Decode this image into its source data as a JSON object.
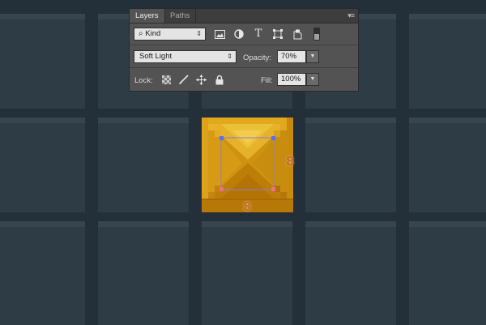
{
  "panel": {
    "tabs": [
      {
        "label": "Layers",
        "active": true
      },
      {
        "label": "Paths",
        "active": false
      }
    ],
    "menu_icon": "panel-menu-icon",
    "filter": {
      "icon": "search-icon",
      "value": "Kind",
      "filter_icons": [
        "image-filter-icon",
        "adjustment-filter-icon",
        "type-filter-icon",
        "shape-filter-icon",
        "smart-object-filter-icon",
        "filter-toggle-icon"
      ]
    },
    "blend_mode": {
      "value": "Soft Light"
    },
    "opacity": {
      "label": "Opacity:",
      "value": "70%"
    },
    "lock": {
      "label": "Lock:",
      "icons": [
        "lock-transparent-pixels-icon",
        "lock-image-pixels-icon",
        "lock-position-icon",
        "lock-all-icon"
      ]
    },
    "fill": {
      "label": "Fill:",
      "value": "100%"
    }
  },
  "canvas": {
    "badge_right": "8",
    "badge_bottom": "8",
    "colors": {
      "background": "#233039",
      "tile": "#2e3c46",
      "gold": "#d59a13",
      "panel": "#535353"
    }
  }
}
